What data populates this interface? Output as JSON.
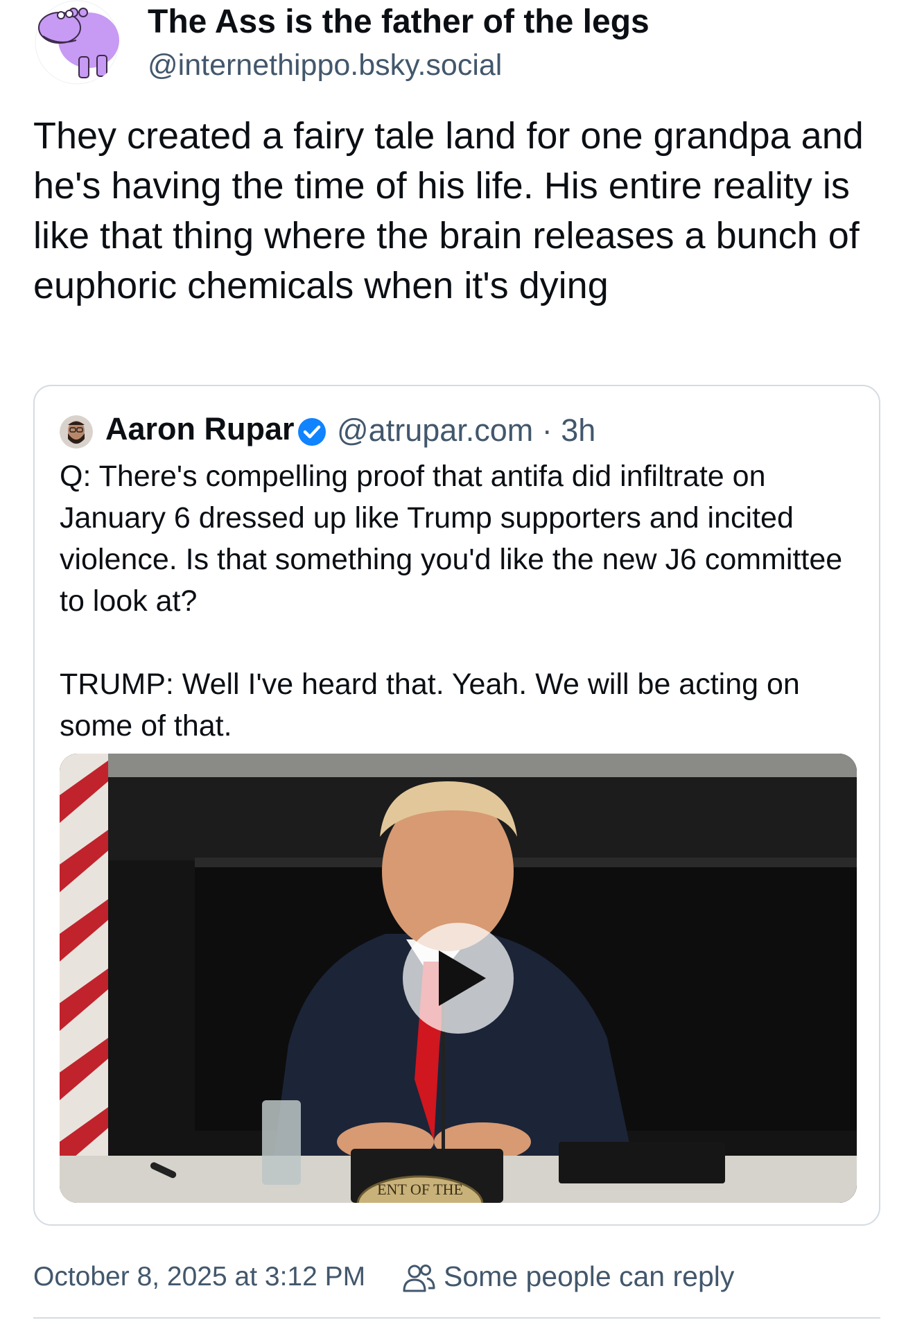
{
  "post": {
    "author": {
      "display_name": "The Ass is the father of the legs",
      "handle": "@internethippo.bsky.social",
      "avatar_icon": "purple-hippo-avatar"
    },
    "text": "They created a fairy tale land for one grandpa and he's having the time of his life. His entire reality is like that thing where the brain releases a bunch of euphoric chemicals when it's dying"
  },
  "quote": {
    "author": {
      "display_name": "Aaron Rupar",
      "verified_icon": "verified-check-icon",
      "meta": "@atrupar.com · 3h"
    },
    "text": "Q: There's compelling proof that antifa did infiltrate on January 6 dressed up like Trump supporters and incited violence. Is that something you'd like the new J6 committee to look at?\n\nTRUMP: Well I've heard that. Yeah. We will be acting on some of that.",
    "video": {
      "play_icon": "play-icon",
      "seal_text": "ENT OF THE"
    }
  },
  "footer": {
    "timestamp": "October 8, 2025 at 3:12 PM",
    "reply_icon": "people-icon",
    "reply_setting": "Some people can reply"
  },
  "colors": {
    "text": "#0b0f14",
    "muted": "#42576c",
    "border": "#d4dbe2",
    "verified": "#1083fe",
    "hippo": "#c79af3"
  }
}
